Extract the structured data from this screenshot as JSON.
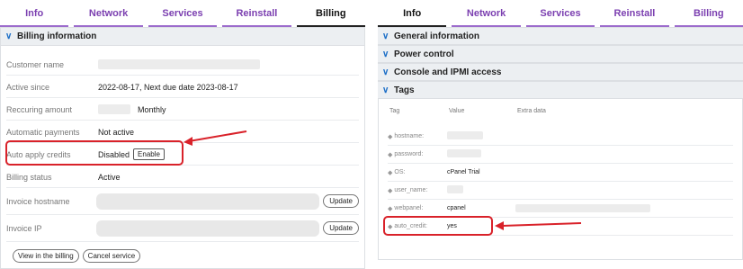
{
  "left": {
    "tabs": [
      {
        "label": "Info",
        "active": false
      },
      {
        "label": "Network",
        "active": false
      },
      {
        "label": "Services",
        "active": false
      },
      {
        "label": "Reinstall",
        "active": false
      },
      {
        "label": "Billing",
        "active": true
      }
    ],
    "section_title": "Billing information",
    "rows": {
      "customer_name": {
        "label": "Customer name"
      },
      "active_since": {
        "label": "Active since",
        "value": "2022-08-17, Next due date 2023-08-17"
      },
      "recurring": {
        "label": "Reccuring amount",
        "value": "Monthly"
      },
      "auto_payments": {
        "label": "Automatic payments",
        "value": "Not active"
      },
      "auto_credits": {
        "label": "Auto apply credits",
        "value": "Disabled",
        "button": "Enable"
      },
      "billing_status": {
        "label": "Billing status",
        "value": "Active"
      },
      "invoice_hostname": {
        "label": "Invoice hostname",
        "button": "Update"
      },
      "invoice_ip": {
        "label": "Invoice IP",
        "button": "Update"
      }
    },
    "footer": {
      "view_billing": "View in the billing",
      "cancel": "Cancel service"
    }
  },
  "right": {
    "tabs": [
      {
        "label": "Info",
        "active": true
      },
      {
        "label": "Network",
        "active": false
      },
      {
        "label": "Services",
        "active": false
      },
      {
        "label": "Reinstall",
        "active": false
      },
      {
        "label": "Billing",
        "active": false
      }
    ],
    "sections": [
      "General information",
      "Power control",
      "Console and IPMI access",
      "Tags"
    ],
    "tag_columns": [
      "Tag",
      "Value",
      "Extra data"
    ],
    "tags": [
      {
        "key": "hostname:",
        "value": ""
      },
      {
        "key": "password:",
        "value": ""
      },
      {
        "key": "OS:",
        "value": "cPanel Trial"
      },
      {
        "key": "user_name:",
        "value": ""
      },
      {
        "key": "webpanel:",
        "value": "cpanel"
      },
      {
        "key": "auto_credit:",
        "value": "yes"
      }
    ]
  },
  "colors": {
    "accent": "#7b3fb0",
    "chevron": "#1d6fc7",
    "highlight": "#d9222a"
  }
}
